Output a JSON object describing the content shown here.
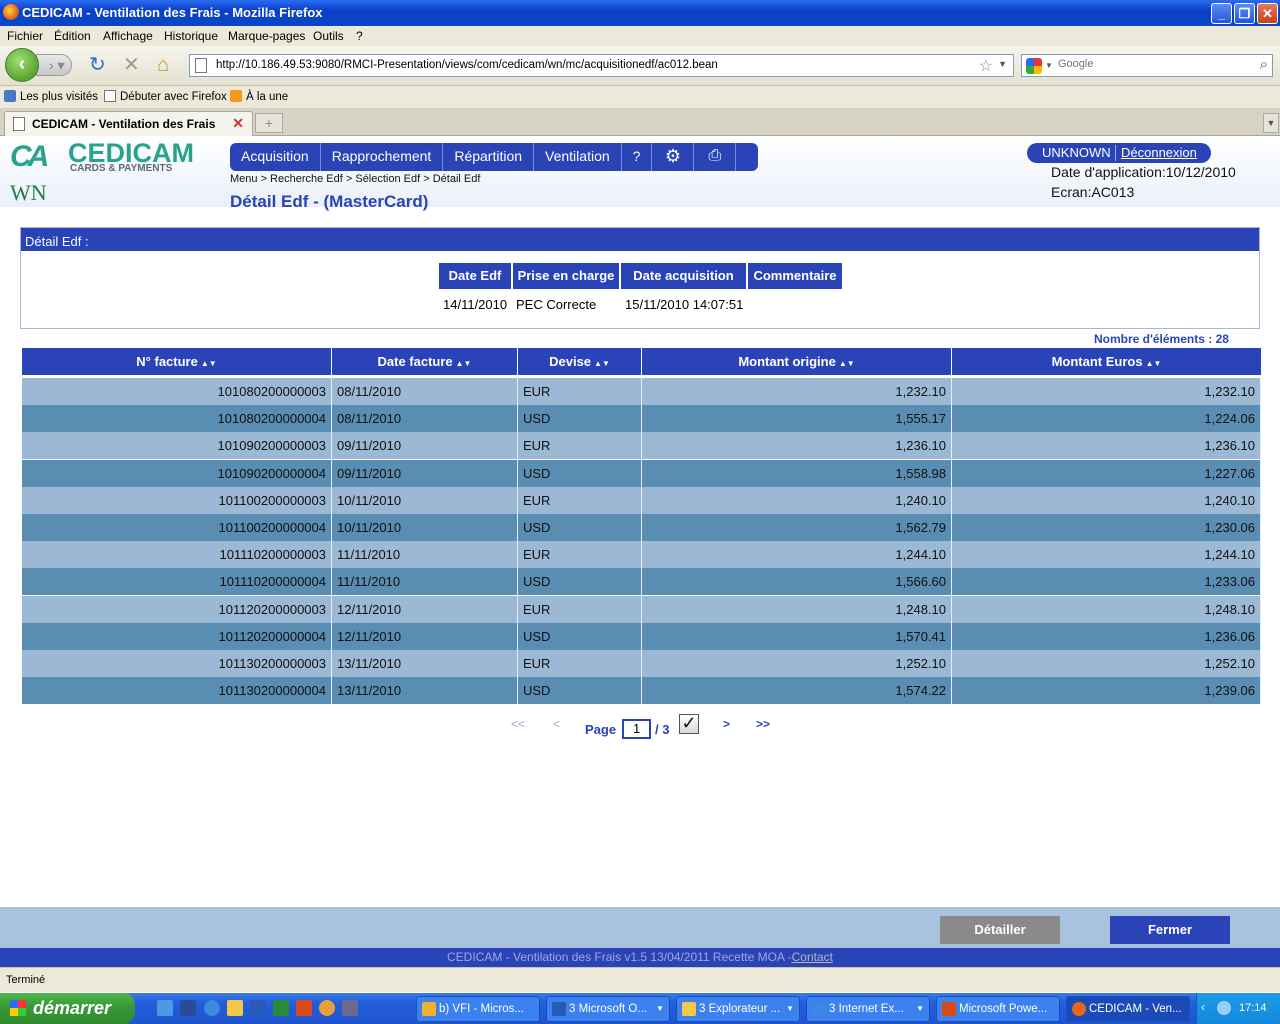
{
  "window": {
    "title": "CEDICAM - Ventilation des Frais - Mozilla Firefox"
  },
  "menu": [
    "Fichier",
    "Édition",
    "Affichage",
    "Historique",
    "Marque-pages",
    "Outils",
    "?"
  ],
  "url": "http://10.186.49.53:9080/RMCI-Presentation/views/com/cedicam/wn/mc/acquisitionedf/ac012.bean",
  "search_placeholder": "Google",
  "bookmarks": [
    "Les plus visités",
    "Débuter avec Firefox",
    "À la une"
  ],
  "tab": {
    "title": "CEDICAM - Ventilation des Frais"
  },
  "app": {
    "logo_main": "CEDICAM",
    "logo_sub": "CARDS & PAYMENTS",
    "logo_ca": "CA",
    "module": "WN",
    "menu": [
      "Acquisition",
      "Rapprochement",
      "Répartition",
      "Ventilation",
      "?"
    ],
    "breadcrumb": "Menu > Recherche Edf > Sélection Edf > Détail Edf",
    "page_title": "Détail Edf - (MasterCard)",
    "user": "UNKNOWN",
    "logout": "Déconnexion",
    "app_date": "Date d'application:10/12/2010",
    "screen": "Ecran:AC013"
  },
  "detail": {
    "header": "Détail Edf :",
    "columns": [
      "Date Edf",
      "Prise en charge",
      "Date acquisition",
      "Commentaire"
    ],
    "values": [
      "14/11/2010",
      "PEC Correcte",
      "15/11/2010 14:07:51",
      ""
    ]
  },
  "count_label": "Nombre d'éléments :",
  "count_value": "28",
  "table": {
    "columns": [
      "N° facture",
      "Date facture",
      "Devise",
      "Montant origine",
      "Montant Euros"
    ],
    "rows": [
      [
        "101080200000003",
        "08/11/2010",
        "EUR",
        "1,232.10",
        "1,232.10"
      ],
      [
        "101080200000004",
        "08/11/2010",
        "USD",
        "1,555.17",
        "1,224.06"
      ],
      [
        "101090200000003",
        "09/11/2010",
        "EUR",
        "1,236.10",
        "1,236.10"
      ],
      [
        "101090200000004",
        "09/11/2010",
        "USD",
        "1,558.98",
        "1,227.06"
      ],
      [
        "101100200000003",
        "10/11/2010",
        "EUR",
        "1,240.10",
        "1,240.10"
      ],
      [
        "101100200000004",
        "10/11/2010",
        "USD",
        "1,562.79",
        "1,230.06"
      ],
      [
        "101110200000003",
        "11/11/2010",
        "EUR",
        "1,244.10",
        "1,244.10"
      ],
      [
        "101110200000004",
        "11/11/2010",
        "USD",
        "1,566.60",
        "1,233.06"
      ],
      [
        "101120200000003",
        "12/11/2010",
        "EUR",
        "1,248.10",
        "1,248.10"
      ],
      [
        "101120200000004",
        "12/11/2010",
        "USD",
        "1,570.41",
        "1,236.06"
      ],
      [
        "101130200000003",
        "13/11/2010",
        "EUR",
        "1,252.10",
        "1,252.10"
      ],
      [
        "101130200000004",
        "13/11/2010",
        "USD",
        "1,574.22",
        "1,239.06"
      ]
    ]
  },
  "pager": {
    "first": "<<",
    "prev": "<",
    "label": "Page",
    "current": "1",
    "total": "/ 3",
    "next": ">",
    "last": ">>"
  },
  "buttons": {
    "detail": "Détailler",
    "close": "Fermer"
  },
  "footer": {
    "text": "CEDICAM - Ventilation des Frais v1.5 13/04/2011 Recette MOA -",
    "contact": "Contact"
  },
  "status": "Terminé",
  "taskbar": {
    "start": "démarrer",
    "items": [
      "b) VFI - Micros...",
      "3 Microsoft O...",
      "3 Explorateur ...",
      "3 Internet Ex...",
      "Microsoft Powe...",
      "CEDICAM - Ven..."
    ],
    "clock": "17:14"
  },
  "colors": {
    "brand": "#2a44b8",
    "row_light": "#9bb8d4",
    "row_dark": "#5a8db2",
    "logo": "#2aa38e"
  }
}
